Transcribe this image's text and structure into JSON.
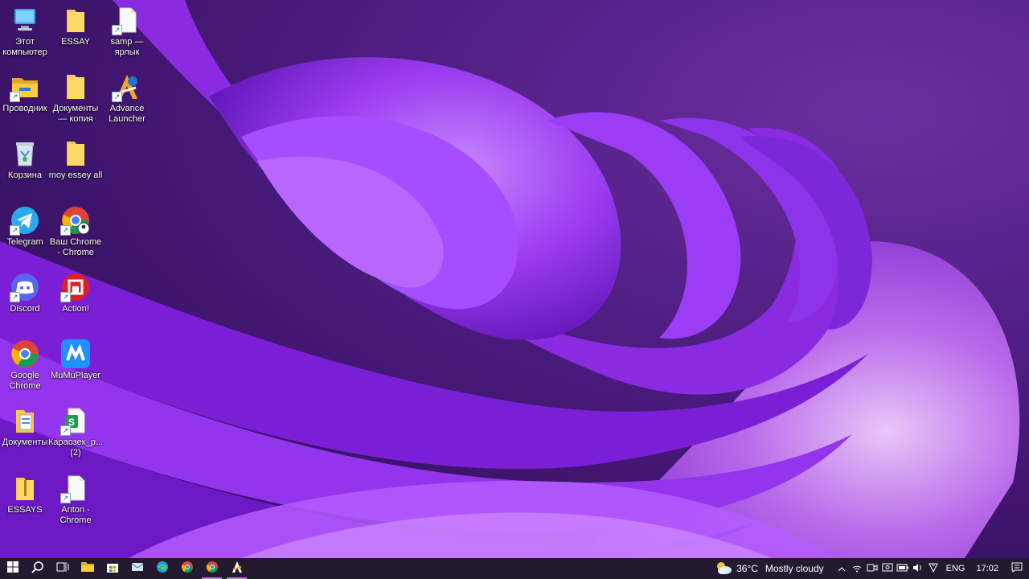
{
  "desktop": {
    "icons": [
      {
        "label": "Этот компьютер",
        "icon": "computer-icon"
      },
      {
        "label": "ESSAY",
        "icon": "folder-icon"
      },
      {
        "label": "samp — ярлык",
        "icon": "file-icon"
      },
      {
        "label": "Проводник",
        "icon": "file-explorer-icon"
      },
      {
        "label": "Документы — копия",
        "icon": "folder-icon"
      },
      {
        "label": "Advance Launcher",
        "icon": "advance-launcher-icon"
      },
      {
        "label": "Корзина",
        "icon": "recycle-bin-icon"
      },
      {
        "label": "moy essey all",
        "icon": "folder-icon"
      },
      {
        "label": "Telegram",
        "icon": "telegram-icon"
      },
      {
        "label": "Ваш Chrome - Chrome",
        "icon": "chrome-profile-icon"
      },
      {
        "label": "Discord",
        "icon": "discord-icon"
      },
      {
        "label": "Action!",
        "icon": "action-icon"
      },
      {
        "label": "Google Chrome",
        "icon": "chrome-icon"
      },
      {
        "label": "MuMuPlayer",
        "icon": "mumuplayer-icon"
      },
      {
        "label": "Документы",
        "icon": "documents-folder-icon"
      },
      {
        "label": "Караозек_р... (2)",
        "icon": "spreadsheet-icon"
      },
      {
        "label": "ESSAYS",
        "icon": "zip-folder-icon"
      },
      {
        "label": "Anton - Chrome",
        "icon": "file-icon"
      }
    ]
  },
  "taskbar": {
    "apps": [
      "start-icon",
      "search-icon",
      "task-view-icon",
      "file-explorer-icon",
      "store-icon",
      "mail-icon",
      "edge-icon",
      "chrome-icon",
      "chrome-icon",
      "advance-launcher-icon"
    ],
    "weather": {
      "temp": "36°C",
      "condition": "Mostly cloudy"
    },
    "language": "ENG",
    "time": "17:02"
  },
  "colors": {
    "taskbar": "#241a2f",
    "accent": "#c17bd9"
  }
}
